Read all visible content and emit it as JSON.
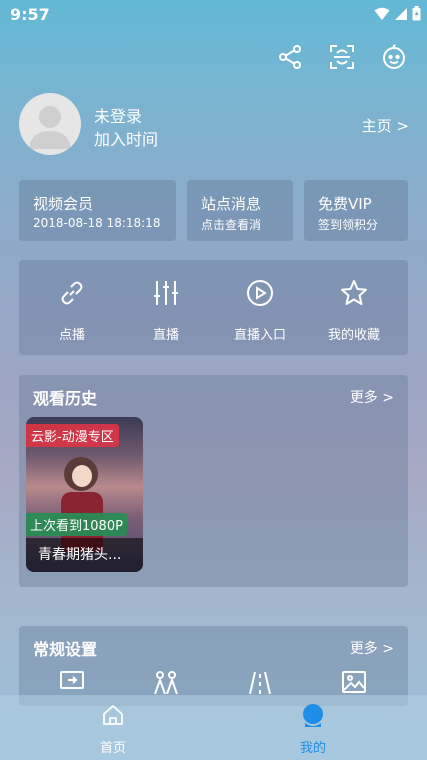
{
  "status_bar": {
    "time": "9:57"
  },
  "top_actions": [
    "share-icon",
    "scan-icon",
    "face-icon"
  ],
  "profile": {
    "name": "未登录",
    "join_time": "加入时间",
    "homepage_link": "主页 >"
  },
  "info_cards": [
    {
      "title": "视频会员",
      "subtitle": "2018-08-18 18:18:18"
    },
    {
      "title": "站点消息",
      "subtitle": "点击查看消"
    },
    {
      "title": "免费VIP",
      "subtitle": "签到领积分"
    }
  ],
  "quick_actions": [
    {
      "label": "点播",
      "icon": "link-icon"
    },
    {
      "label": "直播",
      "icon": "equalizer-icon"
    },
    {
      "label": "直播入口",
      "icon": "play-circle-icon"
    },
    {
      "label": "我的收藏",
      "icon": "star-icon"
    }
  ],
  "history": {
    "title": "观看历史",
    "more": "更多 >",
    "items": [
      {
        "source": "云影-动漫专区",
        "progress": "上次看到1080P",
        "title": "青春期猪头..."
      }
    ]
  },
  "settings": {
    "title": "常规设置",
    "more": "更多 >",
    "icons": [
      "screen-cast-icon",
      "users-icon",
      "road-icon",
      "image-icon"
    ]
  },
  "bottom_nav": [
    {
      "label": "首页",
      "icon": "home-icon",
      "active": false
    },
    {
      "label": "我的",
      "icon": "profile-icon",
      "active": true
    }
  ],
  "colors": {
    "active_tab": "#1e8ee8",
    "source_badge": "#d63647",
    "progress_badge": "#2a8c55"
  }
}
